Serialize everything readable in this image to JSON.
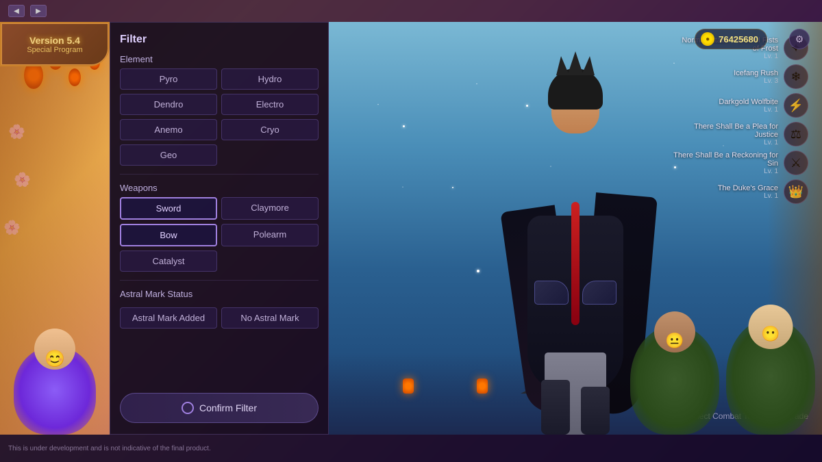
{
  "version": {
    "line1": "Version 5.4",
    "line2": "Special Program"
  },
  "topBar": {
    "leftArrow": "◀",
    "rightArrow": "▶"
  },
  "filter": {
    "title": "Filter",
    "elementSection": "Element",
    "weaponsSection": "Weapons",
    "astralSection": "Astral Mark Status",
    "elements": [
      {
        "label": "Pyro",
        "selected": false
      },
      {
        "label": "Hydro",
        "selected": false
      },
      {
        "label": "Dendro",
        "selected": false
      },
      {
        "label": "Electro",
        "selected": false
      },
      {
        "label": "Anemo",
        "selected": false
      },
      {
        "label": "Cryo",
        "selected": false
      },
      {
        "label": "Geo",
        "selected": false
      }
    ],
    "weapons": [
      {
        "label": "Sword",
        "selected": true
      },
      {
        "label": "Claymore",
        "selected": false
      },
      {
        "label": "Bow",
        "selected": true
      },
      {
        "label": "Polearm",
        "selected": false
      },
      {
        "label": "Catalyst",
        "selected": false
      }
    ],
    "astralOptions": [
      {
        "label": "Astral Mark Added",
        "selected": false
      },
      {
        "label": "No Astral Mark",
        "selected": false
      }
    ],
    "confirmBtn": "Confirm Filter"
  },
  "currency": {
    "amount": "76425680",
    "icon": "●"
  },
  "skills": [
    {
      "name": "Normal Attack: Forceful Fists of Frost",
      "level": "Lv. 1",
      "icon": "✦"
    },
    {
      "name": "Icefang Rush",
      "level": "Lv. 3",
      "icon": "❄"
    },
    {
      "name": "Darkgold Wolfbite",
      "level": "Lv. 1",
      "icon": "⚡"
    },
    {
      "name": "There Shall Be a Plea for Justice",
      "level": "Lv. 1",
      "icon": "⚖"
    },
    {
      "name": "There Shall Be a Reckoning for Sin",
      "level": "Lv. 1",
      "icon": "⚔"
    },
    {
      "name": "The Duke's Grace",
      "level": "Lv. 1",
      "icon": "👑"
    }
  ],
  "selectTalent": "Select Combat Talent to Upgrade",
  "disclaimer": "This is under development and is not indicative of the final product.",
  "settings": "⚙"
}
